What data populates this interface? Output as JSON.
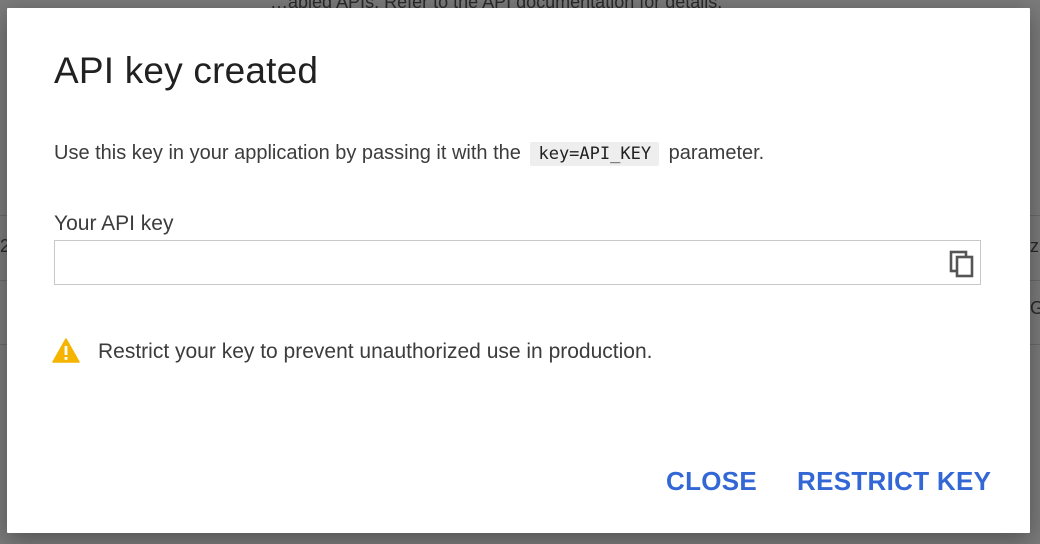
{
  "background": {
    "partial_lines": [
      "…abled APIs. Refer to the API documentation for details.",
      "2",
      "z",
      "G"
    ]
  },
  "dialog": {
    "title": "API key created",
    "description_before": "Use this key in your application by passing it with the",
    "description_code": "key=API_KEY",
    "description_after": "parameter.",
    "key_label": "Your API key",
    "key_value": "",
    "copy_icon": "copy-icon",
    "warning_icon": "warning-icon",
    "warning_text": "Restrict your key to prevent unauthorized use in production.",
    "close_label": "CLOSE",
    "restrict_label": "RESTRICT KEY"
  },
  "colors": {
    "accent": "#3367d6",
    "warning": "#f4b400",
    "backdrop": "#7b7b7b"
  }
}
